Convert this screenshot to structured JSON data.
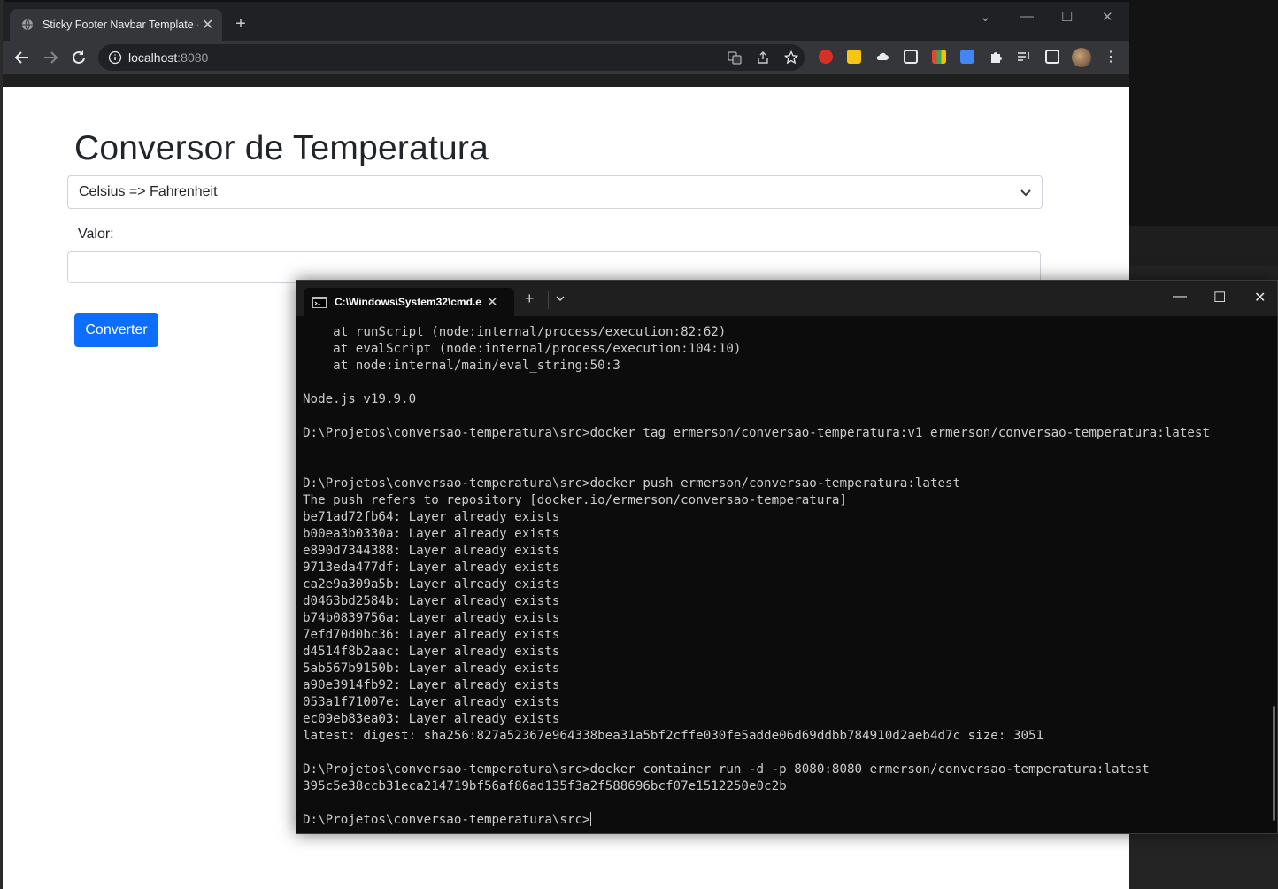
{
  "browser": {
    "tab_title": "Sticky Footer Navbar Template · B",
    "url_host": "localhost",
    "url_port": ":8080"
  },
  "page": {
    "heading": "Conversor de Temperatura",
    "select_value": "Celsius => Fahrenheit",
    "label_valor": "Valor:",
    "input_value": "",
    "button_label": "Converter"
  },
  "terminal": {
    "tab_title": "C:\\Windows\\System32\\cmd.e",
    "lines": [
      "    at runScript (node:internal/process/execution:82:62)",
      "    at evalScript (node:internal/process/execution:104:10)",
      "    at node:internal/main/eval_string:50:3",
      "",
      "Node.js v19.9.0",
      "",
      "D:\\Projetos\\conversao-temperatura\\src>docker tag ermerson/conversao-temperatura:v1 ermerson/conversao-temperatura:latest",
      "",
      "",
      "D:\\Projetos\\conversao-temperatura\\src>docker push ermerson/conversao-temperatura:latest",
      "The push refers to repository [docker.io/ermerson/conversao-temperatura]",
      "be71ad72fb64: Layer already exists",
      "b00ea3b0330a: Layer already exists",
      "e890d7344388: Layer already exists",
      "9713eda477df: Layer already exists",
      "ca2e9a309a5b: Layer already exists",
      "d0463bd2584b: Layer already exists",
      "b74b0839756a: Layer already exists",
      "7efd70d0bc36: Layer already exists",
      "d4514f8b2aac: Layer already exists",
      "5ab567b9150b: Layer already exists",
      "a90e3914fb92: Layer already exists",
      "053a1f71007e: Layer already exists",
      "ec09eb83ea03: Layer already exists",
      "latest: digest: sha256:827a52367e964338bea31a5bf2cffe030fe5adde06d69ddbb784910d2aeb4d7c size: 3051",
      "",
      "D:\\Projetos\\conversao-temperatura\\src>docker container run -d -p 8080:8080 ermerson/conversao-temperatura:latest",
      "395c5e38ccb31eca214719bf56af86ad135f3a2f588696bcf07e1512250e0c2b",
      ""
    ],
    "prompt": "D:\\Projetos\\conversao-temperatura\\src>"
  }
}
